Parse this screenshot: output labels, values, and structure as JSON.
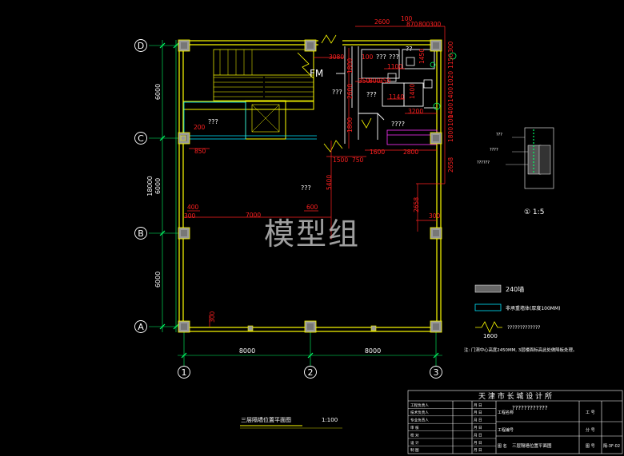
{
  "colors": {
    "wall": "#ffff00",
    "dim": "#ff2020",
    "axis": "#00ff66",
    "column": "#9a9a9a",
    "cyan": "#00e5ff",
    "white": "#ffffff",
    "magenta": "#ff33ff"
  },
  "grid": {
    "rows": [
      {
        "label": "D"
      },
      {
        "label": "C"
      },
      {
        "label": "B"
      },
      {
        "label": "A"
      }
    ],
    "cols": [
      {
        "label": "1"
      },
      {
        "label": "2"
      },
      {
        "label": "3"
      }
    ],
    "left_dims": [
      "6000",
      "6000",
      "6000"
    ],
    "left_total": "18000",
    "bottom_dims": [
      "8000",
      "8000"
    ]
  },
  "dims": {
    "top": [
      "2600",
      "100",
      "870",
      "800",
      "300"
    ],
    "right": [
      "300",
      "1150",
      "1020",
      "1400",
      "1400",
      "100",
      "1800"
    ],
    "d_3080": "3080",
    "d_100": "100",
    "d_1100": "1100",
    "d_3500": "350",
    "d_800": "800",
    "d_350": "350",
    "d_1140": "1140",
    "d_1400": "1400",
    "d_1450": "1450",
    "d_3200": "3200",
    "d_2800": "2800",
    "d_1600": "1600",
    "d_1500": "1500",
    "d_750": "750",
    "d_1800a": "1800",
    "d_1800b": "1800",
    "d_2600v": "2600",
    "d_200": "200",
    "d_850": "850",
    "d_2658a": "2658",
    "d_2658b": "2658",
    "d_400": "400",
    "d_600": "600",
    "d_300a": "300",
    "d_300b": "300",
    "d_300c": "300",
    "d_7000": "7000",
    "d_5400": "5400"
  },
  "labels": {
    "fm": "FM",
    "q1": "???",
    "q2": "???",
    "q3": "???",
    "q4": "???",
    "q5": "???",
    "q6": "??",
    "q7": "????",
    "q8": "???",
    "watermark": "模型组"
  },
  "detail": {
    "scale": "① 1:5",
    "labels": [
      "???",
      "????",
      "??????"
    ]
  },
  "legend": {
    "items": [
      "240墙",
      "非承重墙体(厚度100MM)",
      "?????????????"
    ],
    "dim": "1600",
    "note": "注: 门洞中心高度2450MM, 3层楼面标高此处做降板处理。"
  },
  "drawing_title": "三层隔墙位置平面图",
  "drawing_scale": "1:100",
  "title_block": {
    "company": "天 津 市 长 城 设 计 所",
    "roles": [
      "工程负责人",
      "技术负责人",
      "专业负责人",
      "审 核",
      "校 对",
      "设 计",
      "制 图"
    ],
    "stamp": "月 日",
    "project_label": "工程名称",
    "project_name": "????????????",
    "sub_label": "工程编号",
    "name_label": "图 名",
    "name_value": "三层隔墙位置平面图",
    "right_labels": [
      "工 号",
      "分 号",
      "图 号"
    ],
    "drawing_no": "隔-3F-02"
  }
}
